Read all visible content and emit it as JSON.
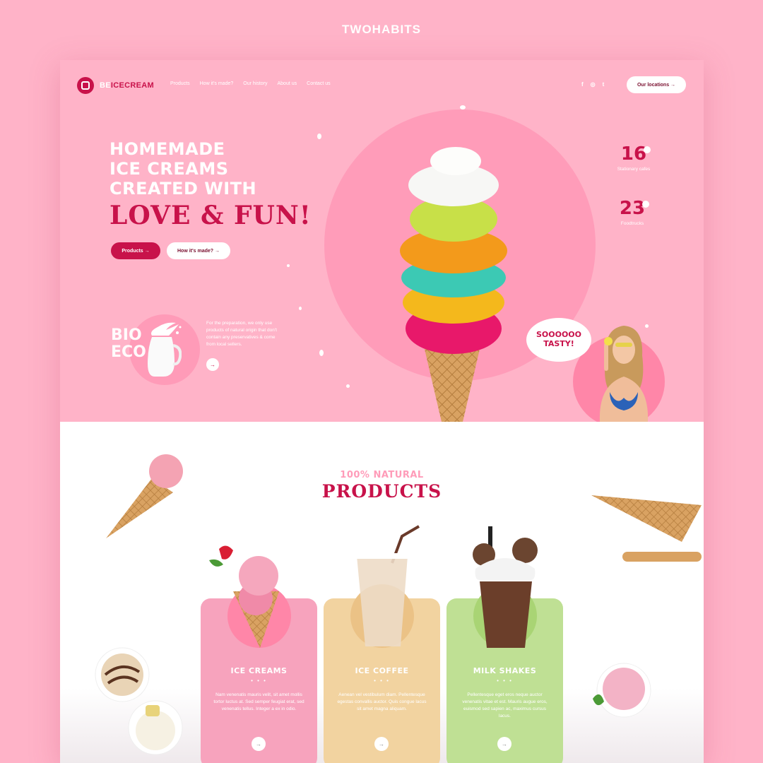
{
  "top_brand": "TWOHABITS",
  "nav": {
    "logo": {
      "prefix": "BE",
      "suffix": "ICECREAM"
    },
    "links": [
      "Products",
      "How it's made?",
      "Our history",
      "About us",
      "Contact us"
    ],
    "social": [
      "f",
      "◎",
      "t"
    ],
    "social_icons": [
      "facebook-icon",
      "instagram-icon",
      "twitter-icon"
    ],
    "locations_button": "Our locations →"
  },
  "hero": {
    "headline_lines": [
      "HOMEMADE",
      "ICE CREAMS",
      "CREATED WITH"
    ],
    "accent_line": "LOVE & FUN!",
    "primary_button": "Products →",
    "secondary_button": "How it's made? →",
    "bio": {
      "word_lines": [
        "BIO",
        "ECO"
      ],
      "text": "For the preparation, we only use products of natural origin that don't contain any preservatives & come from local sellers.",
      "arrow": "→"
    },
    "stats": [
      {
        "number": "16",
        "label": "Stationary cafes"
      },
      {
        "number": "23",
        "label": "Foodtrucks"
      }
    ],
    "bubble": "SOOOOOO TASTY!"
  },
  "products": {
    "subtitle": "100% NATURAL",
    "title": "PRODUCTS",
    "cards": [
      {
        "name": "ICE CREAMS",
        "dots": "• • •",
        "desc": "Nam venenatis mauris velit, sit amet mollis tortor luctus at. Sed semper feugiat erat, sed venenatis tellus. Integer a ex in odio.",
        "arrow": "→",
        "color": "#f7a3bd",
        "circle": "#ff86a8"
      },
      {
        "name": "ICE COFFEE",
        "dots": "• • •",
        "desc": "Aenean vel vestibulum diam. Pellentesque egestas convallis auctor. Quis congue lacus sit amet magna aliquam.",
        "arrow": "→",
        "color": "#f2d3a0",
        "circle": "#ebc286"
      },
      {
        "name": "MILK SHAKES",
        "dots": "• • •",
        "desc": "Pellentesque eget eros neque auctor venenatis vitae et est. Mauris augue eros, euismod sed sapien ac, maximus cursus lacus.",
        "arrow": "→",
        "color": "#bfe094",
        "circle": "#a9d474"
      }
    ]
  }
}
